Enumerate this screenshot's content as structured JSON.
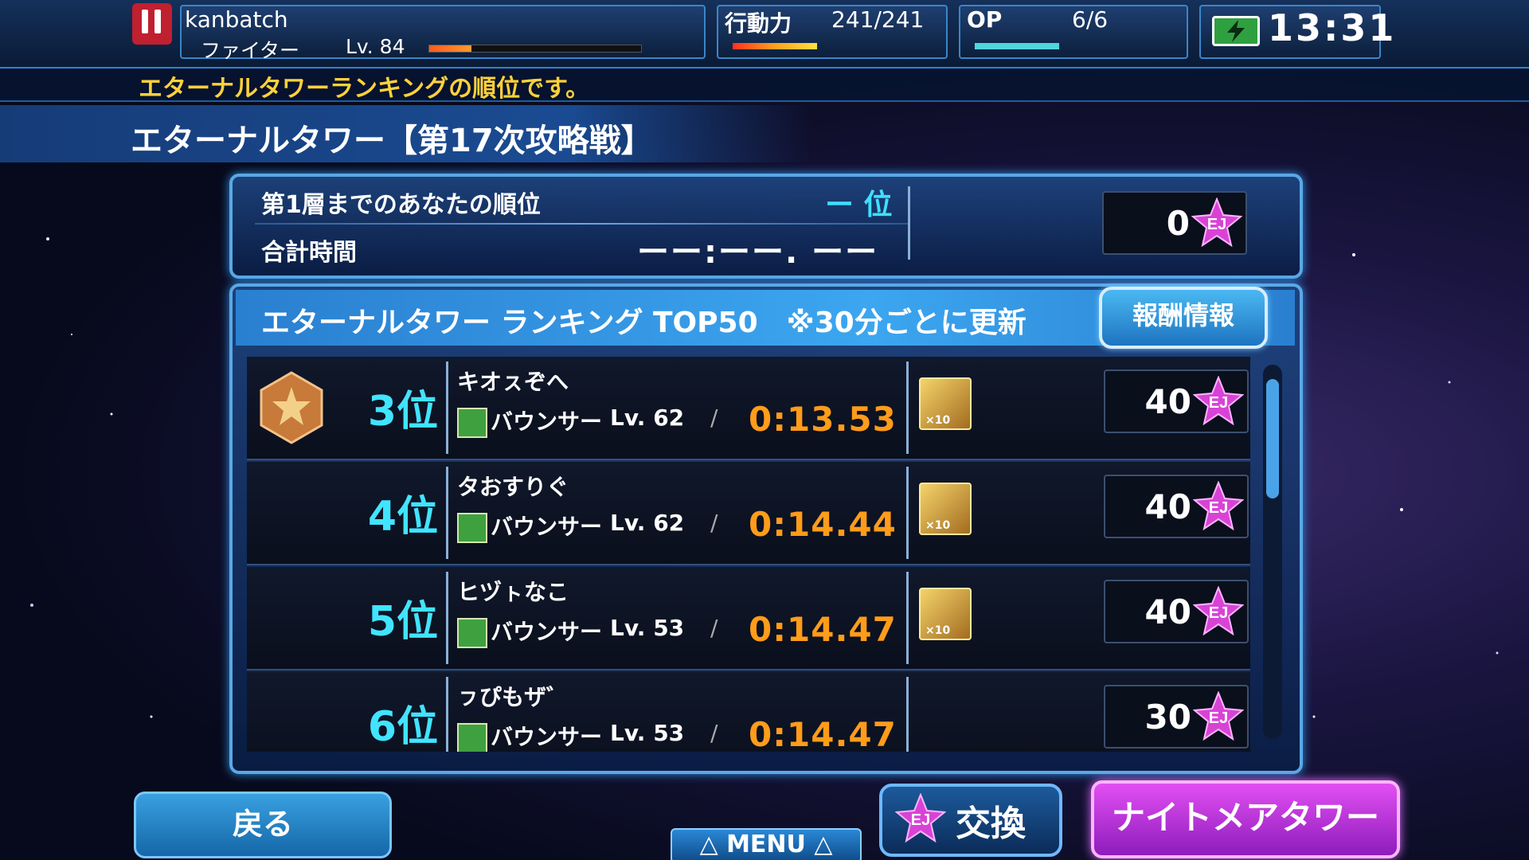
{
  "header": {
    "player_name": "kanbatch",
    "player_class": "ファイター",
    "level_text": "Lv. 84",
    "exp_progress": 0.2,
    "stamina_label": "行動力",
    "stamina_value": "241/241",
    "stamina_progress": 1.0,
    "op_label": "OP",
    "op_value": "6/6",
    "op_progress": 1.0,
    "clock": "13:31",
    "battery_icon": "battery-charging-icon"
  },
  "message": "エターナルタワーランキングの順位です。",
  "page_title": "エターナルタワー【第17次攻略戦】",
  "my_rank": {
    "rank_label": "第1層までのあなたの順位",
    "rank_value": "ー 位",
    "time_label": "合計時間",
    "time_value": "ーー:ーー. ーー",
    "ej_value": "0"
  },
  "ranking": {
    "title": "エターナルタワー ランキング TOP50　※30分ごとに更新",
    "reward_button": "報酬情報",
    "rows": [
      {
        "rank": "3位",
        "name": "キオㇲぞへ",
        "class": "バウンサー",
        "level": "Lv. 62",
        "time": "0:13.53",
        "reward_badge": "×10",
        "ej": "40",
        "medal": true,
        "reward_icon": true
      },
      {
        "rank": "4位",
        "name": "タおすりぐ",
        "class": "バウンサー",
        "level": "Lv. 62",
        "time": "0:14.44",
        "reward_badge": "×10",
        "ej": "40",
        "medal": false,
        "reward_icon": true
      },
      {
        "rank": "5位",
        "name": "ヒヅㇳなこ",
        "class": "バウンサー",
        "level": "Lv. 53",
        "time": "0:14.47",
        "reward_badge": "×10",
        "ej": "40",
        "medal": false,
        "reward_icon": true
      },
      {
        "rank": "6位",
        "name": "ㇷぴもザ゛",
        "class": "バウンサー",
        "level": "Lv. 53",
        "time": "0:14.47",
        "reward_badge": "",
        "ej": "30",
        "medal": false,
        "reward_icon": false
      }
    ]
  },
  "footer": {
    "back_button": "戻る",
    "menu_button": "△ MENU △",
    "exchange_button": "交換",
    "nightmare_button": "ナイトメアタワー ≫"
  },
  "ej_label": "EJ",
  "colors": {
    "accent": "#41e4ff",
    "time": "#ff9c1a",
    "message": "#ffd23a",
    "ej_star": "#d843d6"
  }
}
